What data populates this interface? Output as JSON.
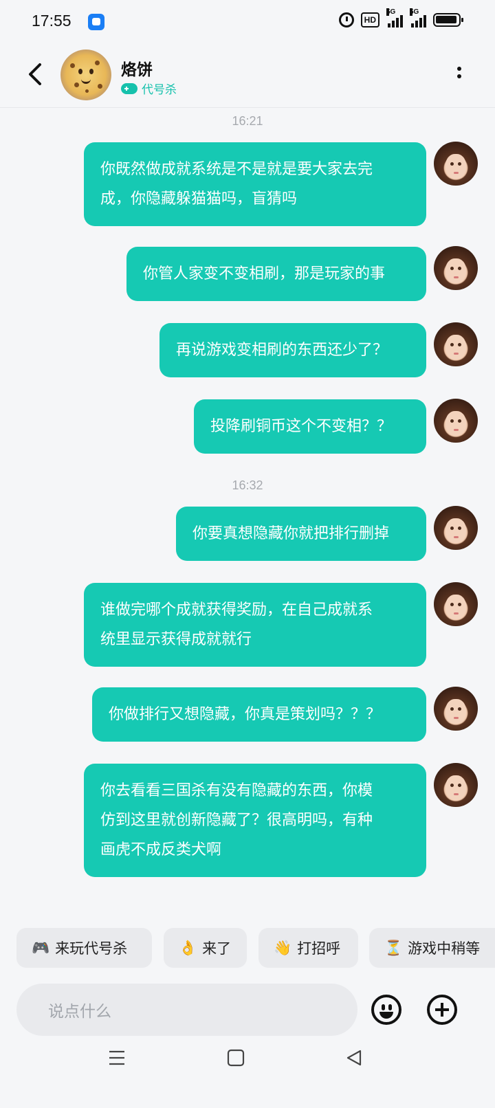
{
  "status_bar": {
    "time": "17:55",
    "hd_label": "HD",
    "sim1": "5G",
    "sim2": "5G"
  },
  "header": {
    "name": "烙饼",
    "game": "代号杀"
  },
  "chat": {
    "timestamps": [
      "16:21",
      "16:32"
    ],
    "messages": [
      {
        "lines": [
          "你既然做成就系统是不是就是要大家去完",
          "成，你隐藏躲猫猫吗，盲猜吗"
        ]
      },
      {
        "lines": [
          "你管人家变不变相刷，那是玩家的事"
        ]
      },
      {
        "lines": [
          "再说游戏变相刷的东西还少了？"
        ]
      },
      {
        "lines": [
          "投降刷铜币这个不变相？？"
        ]
      },
      {
        "lines": [
          "你要真想隐藏你就把排行删掉"
        ]
      },
      {
        "lines": [
          "谁做完哪个成就获得奖励，在自己成就系",
          "统里显示获得成就就行"
        ]
      },
      {
        "lines": [
          "你做排行又想隐藏，你真是策划吗？？？"
        ]
      },
      {
        "lines": [
          "你去看看三国杀有没有隐藏的东西，你模",
          "仿到这里就创新隐藏了？很高明吗，有种",
          "画虎不成反类犬啊"
        ]
      }
    ]
  },
  "quick_replies": [
    {
      "icon": "🎮",
      "label": "来玩代号杀"
    },
    {
      "icon": "👌",
      "label": "来了"
    },
    {
      "icon": "👋",
      "label": "打招呼"
    },
    {
      "icon": "⏳",
      "label": "游戏中稍等"
    }
  ],
  "composer": {
    "placeholder": "说点什么"
  },
  "colors": {
    "bubble": "#16c9b3",
    "accent": "#16c1ac",
    "background": "#f5f6f8"
  }
}
